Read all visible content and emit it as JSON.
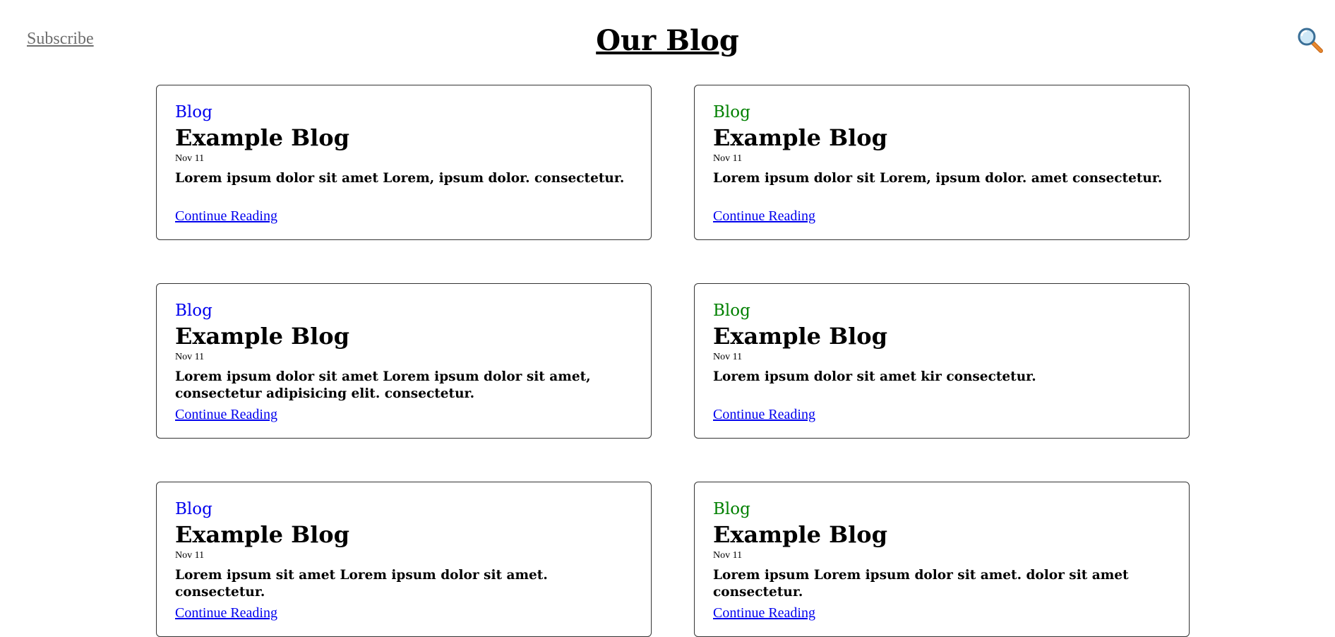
{
  "header": {
    "subscribe_label": "Subscribe",
    "title": "Our Blog",
    "search_icon": "search-icon"
  },
  "colors": {
    "blue_category": "#0000ee",
    "green_category": "#008000",
    "link": "#0000ee"
  },
  "posts": [
    {
      "category": "Blog",
      "title": "Example Blog",
      "date": "Nov 11",
      "excerpt": "Lorem ipsum dolor sit amet Lorem, ipsum dolor. consectetur.",
      "link": "Continue Reading"
    },
    {
      "category": "Blog",
      "title": "Example Blog",
      "date": "Nov 11",
      "excerpt": "Lorem ipsum dolor sit Lorem, ipsum dolor. amet consectetur.",
      "link": "Continue Reading"
    },
    {
      "category": "Blog",
      "title": "Example Blog",
      "date": "Nov 11",
      "excerpt": "Lorem ipsum dolor sit amet Lorem ipsum dolor sit amet, consectetur adipisicing elit. consectetur.",
      "link": "Continue Reading"
    },
    {
      "category": "Blog",
      "title": "Example Blog",
      "date": "Nov 11",
      "excerpt": "Lorem ipsum dolor sit amet kir consectetur.",
      "link": "Continue Reading"
    },
    {
      "category": "Blog",
      "title": "Example Blog",
      "date": "Nov 11",
      "excerpt": "Lorem ipsum sit amet Lorem ipsum dolor sit amet. consectetur.",
      "link": "Continue Reading"
    },
    {
      "category": "Blog",
      "title": "Example Blog",
      "date": "Nov 11",
      "excerpt": "Lorem ipsum Lorem ipsum dolor sit amet. dolor sit amet consectetur.",
      "link": "Continue Reading"
    }
  ]
}
